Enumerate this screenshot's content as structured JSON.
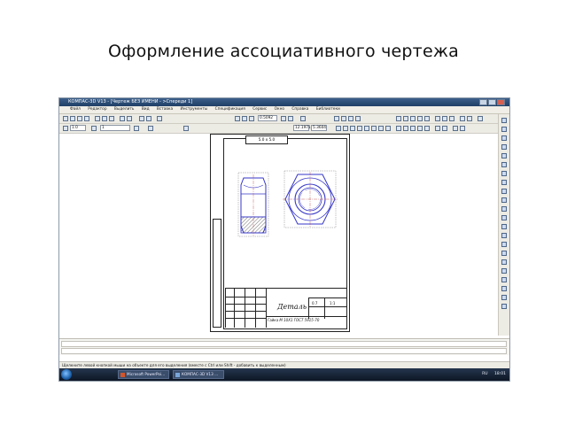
{
  "slide": {
    "title": "Оформление ассоциативного чертежа"
  },
  "window": {
    "title": "КОМПАС-3D V13 - [Чертеж БЕЗ ИМЕНИ - >Спереди 1]"
  },
  "menu": [
    "Файл",
    "Редактор",
    "Выделить",
    "Вид",
    "Вставка",
    "Инструменты",
    "Спецификация",
    "Сервис",
    "Окно",
    "Справка",
    "Библиотеки"
  ],
  "toolbar": {
    "zoom": "0.5092",
    "scale": "1.0",
    "layer": "1",
    "paper": "5.0 x 5.0",
    "coord_x": "12.1971",
    "coord_y": "5.3604"
  },
  "drawing": {
    "name": "Деталь",
    "standard": "Гайка М 10Х1 ГОСТ 5915-70",
    "mass": "0.7",
    "scale": "1:1",
    "corner_label": "5.0 x 5.0"
  },
  "status": {
    "hint": "Щелкните левой кнопкой мыши на объекте для его выделения (вместе с Ctrl или Shift - добавить к выделенным)"
  },
  "taskbar": {
    "items": [
      "Microsoft PowerPoi...",
      "КОМПАС-3D V13 ..."
    ],
    "lang": "RU",
    "time": "18:01"
  },
  "colors": {
    "accent": "#1f3f66",
    "drawing_line": "#3535c8",
    "hatch": "#4b4b4b"
  }
}
